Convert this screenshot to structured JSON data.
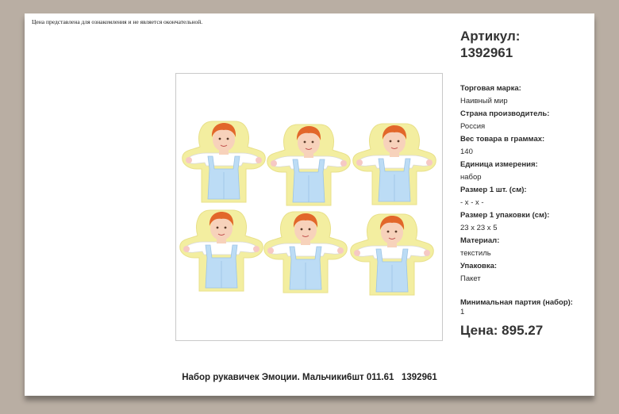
{
  "disclaimer": "Цена представлена для ознакомления и не является окончательной.",
  "article": {
    "label": "Артикул:",
    "number": "1392961"
  },
  "specs": [
    {
      "label": "Торговая марка:",
      "value": "Наивный мир"
    },
    {
      "label": "Страна производитель:",
      "value": "Россия"
    },
    {
      "label": "Вес товара в граммах:",
      "value": "140"
    },
    {
      "label": "Единица измерения:",
      "value": "набор"
    },
    {
      "label": "Размер 1 шт. (см):",
      "value": "- x - x -"
    },
    {
      "label": "Размер 1 упаковки (см):",
      "value": "23 x 23 x 5"
    },
    {
      "label": "Материал:",
      "value": "текстиль"
    },
    {
      "label": "Упаковка:",
      "value": "Пакет"
    }
  ],
  "min_order": {
    "label": "Минимальная партия (набор):",
    "value": "1"
  },
  "price": "Цена: 895.27",
  "caption": "Набор рукавичек Эмоции. Мальчики6шт 011.61   1392961",
  "colors": {
    "background": "#b9aea3",
    "glove_trim": "#f3eea0",
    "overalls": "#bcdcf5",
    "hair": "#e2672a",
    "skin": "#f7d2bb"
  }
}
